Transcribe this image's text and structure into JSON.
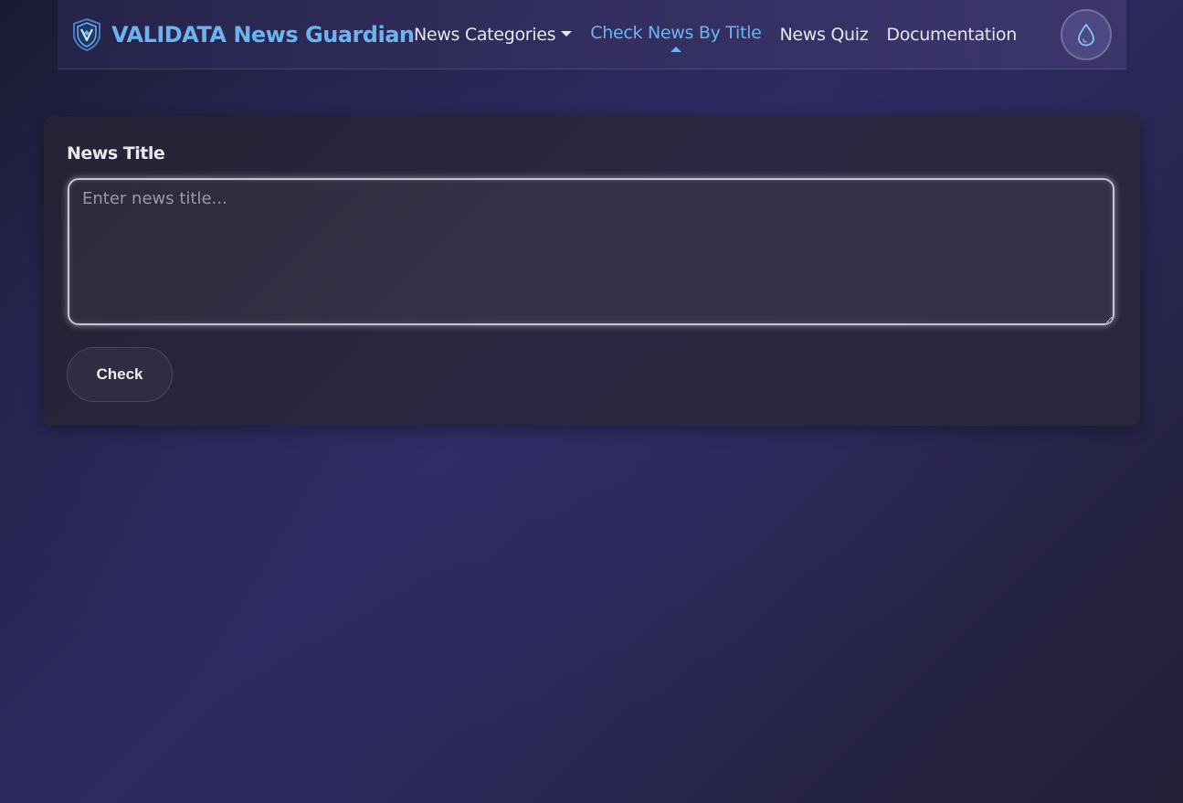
{
  "brand": {
    "name": "VALIDATA News Guardian",
    "logo_icon": "shield-icon",
    "color": "#6cb3f0"
  },
  "nav": {
    "items": [
      {
        "label": "News Categories",
        "has_dropdown": true,
        "active": false
      },
      {
        "label": "Check News By Title",
        "has_dropdown": false,
        "active": true
      },
      {
        "label": "News Quiz",
        "has_dropdown": false,
        "active": false
      },
      {
        "label": "Documentation",
        "has_dropdown": false,
        "active": false
      }
    ],
    "theme_toggle_icon": "droplet-icon"
  },
  "form": {
    "label": "News Title",
    "textarea_placeholder": "Enter news title...",
    "textarea_value": "",
    "submit_label": "Check"
  },
  "colors": {
    "accent": "#6cb3f0",
    "background": "#2e2a62",
    "card": "#2a2840"
  }
}
